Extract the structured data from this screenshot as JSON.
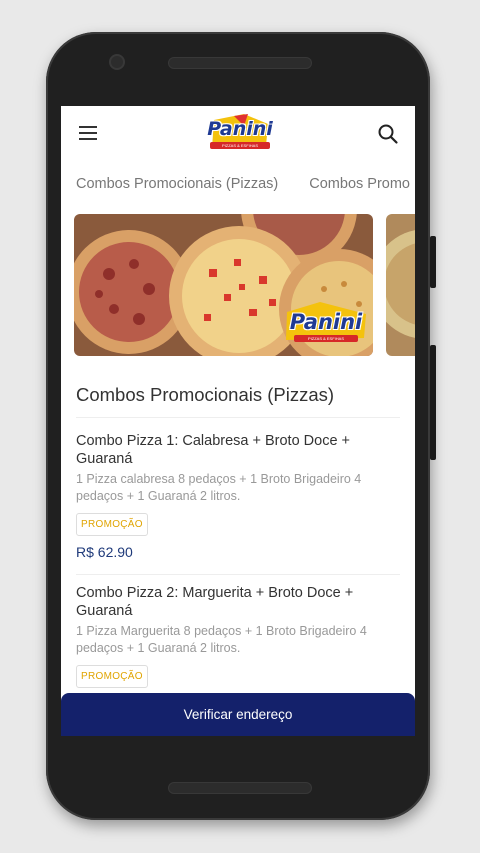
{
  "header": {
    "logo_text": "Panini",
    "logo_subtext": "PIZZAS & ESFIHAS"
  },
  "tabs": [
    {
      "label": "Combos Promocionais (Pizzas)"
    },
    {
      "label": "Combos Promo"
    }
  ],
  "banner": {
    "logo_text": "Panini",
    "logo_subtext": "PIZZAS & ESFIHAS"
  },
  "section": {
    "title": "Combos Promocionais (Pizzas)"
  },
  "products": [
    {
      "name": "Combo Pizza 1: Calabresa + Broto Doce + Guaraná",
      "description": "1 Pizza calabresa 8 pedaços + 1 Broto Brigadeiro 4 pedaços + 1 Guaraná 2 litros.",
      "badge": "PROMOÇÃO",
      "price": "R$ 62.90"
    },
    {
      "name": "Combo Pizza 2: Marguerita + Broto Doce + Guaraná",
      "description": "1 Pizza Marguerita 8 pedaços + 1 Broto Brigadeiro 4 pedaços + 1 Guaraná 2 litros.",
      "badge": "PROMOÇÃO"
    }
  ],
  "cta": {
    "label": "Verificar endereço"
  },
  "colors": {
    "brand_blue": "#14216b",
    "badge_yellow": "#e0a400",
    "price_blue": "#1f3a7a"
  }
}
